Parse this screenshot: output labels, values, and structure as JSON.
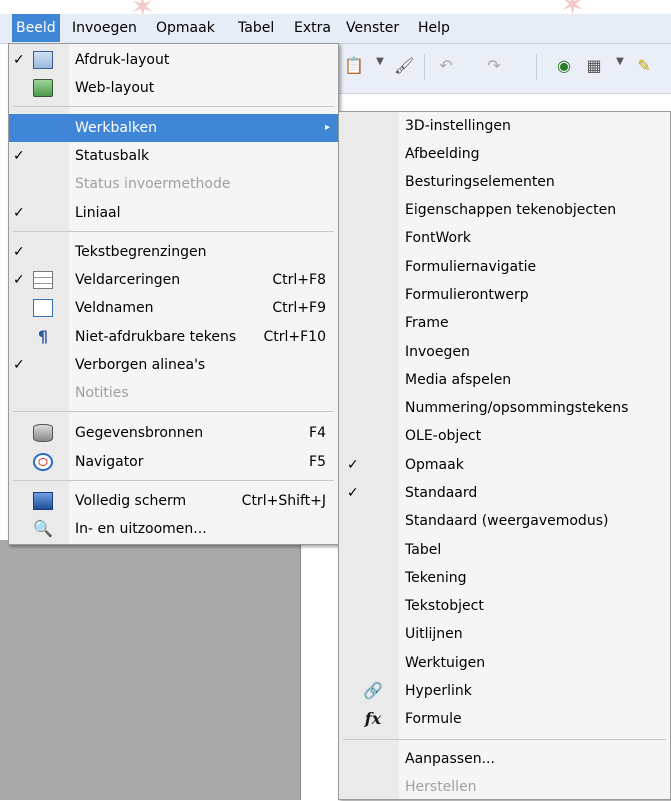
{
  "menubar": {
    "items": [
      "Beeld",
      "Invoegen",
      "Opmaak",
      "Tabel",
      "Extra",
      "Venster",
      "Help"
    ]
  },
  "toolbar": {
    "icons": [
      "paste-icon",
      "dropdown-icon",
      "format-paintbrush-icon",
      "undo-icon",
      "redo-icon",
      "navigator-icon",
      "table-icon",
      "draw-icon"
    ]
  },
  "beeld_menu": {
    "items": [
      {
        "label": "Afdruk-layout",
        "checked": true,
        "icon": "print-layout-icon"
      },
      {
        "label": "Web-layout",
        "checked": false,
        "icon": "web-layout-icon"
      },
      {
        "label": "Werkbalken",
        "submenu": true,
        "highlighted": true
      },
      {
        "label": "Statusbalk",
        "checked": true
      },
      {
        "label": "Status invoermethode",
        "disabled": true
      },
      {
        "label": "Liniaal",
        "checked": true
      },
      {
        "label": "Tekstbegrenzingen",
        "checked": true
      },
      {
        "label": "Veldarceringen",
        "checked": true,
        "icon": "field-shadings-icon",
        "shortcut": "Ctrl+F8"
      },
      {
        "label": "Veldnamen",
        "icon": "field-names-icon",
        "shortcut": "Ctrl+F9"
      },
      {
        "label": "Niet-afdrukbare tekens",
        "icon": "pilcrow-icon",
        "shortcut": "Ctrl+F10"
      },
      {
        "label": "Verborgen alinea's",
        "checked": true
      },
      {
        "label": "Notities",
        "disabled": true
      },
      {
        "label": "Gegevensbronnen",
        "icon": "database-icon",
        "shortcut": "F4"
      },
      {
        "label": "Navigator",
        "icon": "navigator-icon",
        "shortcut": "F5"
      },
      {
        "label": "Volledig scherm",
        "icon": "fullscreen-icon",
        "shortcut": "Ctrl+Shift+J"
      },
      {
        "label": "In- en uitzoomen...",
        "icon": "zoom-icon"
      }
    ]
  },
  "werkbalken_menu": {
    "items": [
      {
        "label": "3D-instellingen"
      },
      {
        "label": "Afbeelding"
      },
      {
        "label": "Besturingselementen"
      },
      {
        "label": "Eigenschappen tekenobjecten"
      },
      {
        "label": "FontWork"
      },
      {
        "label": "Formuliernavigatie"
      },
      {
        "label": "Formulierontwerp"
      },
      {
        "label": "Frame"
      },
      {
        "label": "Invoegen"
      },
      {
        "label": "Media afspelen"
      },
      {
        "label": "Nummering/opsommingstekens"
      },
      {
        "label": "OLE-object"
      },
      {
        "label": "Opmaak",
        "checked": true
      },
      {
        "label": "Standaard",
        "checked": true
      },
      {
        "label": "Standaard (weergavemodus)"
      },
      {
        "label": "Tabel"
      },
      {
        "label": "Tekening"
      },
      {
        "label": "Tekstobject"
      },
      {
        "label": "Uitlijnen"
      },
      {
        "label": "Werktuigen"
      },
      {
        "label": "Hyperlink",
        "icon": "hyperlink-icon"
      },
      {
        "label": "Formule",
        "icon": "formula-icon"
      },
      {
        "label": "Aanpassen..."
      },
      {
        "label": "Herstellen",
        "disabled": true
      }
    ]
  },
  "check_glyph": "✓",
  "arrow_glyph": "▸",
  "colors": {
    "highlight": "#3f86d6",
    "menu_bg": "#f5f5f5",
    "disabled": "#a0a0a0"
  }
}
